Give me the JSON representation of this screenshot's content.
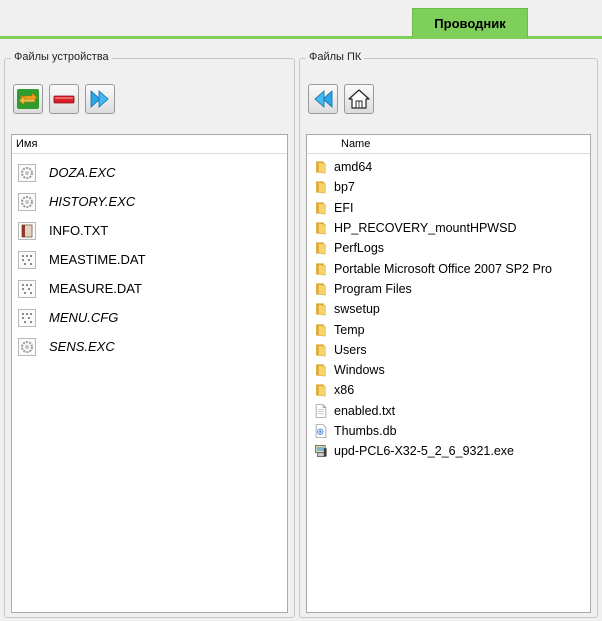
{
  "tab": {
    "label": "Проводник"
  },
  "device_panel": {
    "title": "Файлы устройства",
    "column_header": "Имя",
    "buttons": [
      {
        "name": "sync",
        "icon": "sync-arrows-icon"
      },
      {
        "name": "delete",
        "icon": "minus-icon"
      },
      {
        "name": "forward",
        "icon": "double-arrow-right-icon"
      }
    ],
    "files": [
      {
        "name": "DOZA.EXC",
        "icon": "gear-file-icon",
        "italic": true
      },
      {
        "name": "HISTORY.EXC",
        "icon": "gear-file-icon",
        "italic": true
      },
      {
        "name": "INFO.TXT",
        "icon": "text-file-icon",
        "italic": false
      },
      {
        "name": "MEASTIME.DAT",
        "icon": "data-file-icon",
        "italic": false
      },
      {
        "name": "MEASURE.DAT",
        "icon": "data-file-icon",
        "italic": false
      },
      {
        "name": "MENU.CFG",
        "icon": "data-file-icon",
        "italic": true
      },
      {
        "name": "SENS.EXC",
        "icon": "gear-file-icon",
        "italic": true
      }
    ]
  },
  "pc_panel": {
    "title": "Файлы ПК",
    "column_header": "Name",
    "buttons": [
      {
        "name": "back",
        "icon": "double-arrow-left-icon"
      },
      {
        "name": "home",
        "icon": "home-icon"
      }
    ],
    "files": [
      {
        "name": "amd64",
        "icon": "folder-icon"
      },
      {
        "name": "bp7",
        "icon": "folder-icon"
      },
      {
        "name": "EFI",
        "icon": "folder-icon"
      },
      {
        "name": "HP_RECOVERY_mountHPWSD",
        "icon": "folder-icon"
      },
      {
        "name": "PerfLogs",
        "icon": "folder-icon"
      },
      {
        "name": "Portable Microsoft Office 2007 SP2 Pro",
        "icon": "folder-icon"
      },
      {
        "name": "Program Files",
        "icon": "folder-icon"
      },
      {
        "name": "swsetup",
        "icon": "folder-icon"
      },
      {
        "name": "Temp",
        "icon": "folder-icon"
      },
      {
        "name": "Users",
        "icon": "folder-icon"
      },
      {
        "name": "Windows",
        "icon": "folder-icon"
      },
      {
        "name": "x86",
        "icon": "folder-icon"
      },
      {
        "name": "enabled.txt",
        "icon": "text-document-icon"
      },
      {
        "name": "Thumbs.db",
        "icon": "db-file-icon"
      },
      {
        "name": "upd-PCL6-X32-5_2_6_9321.exe",
        "icon": "exe-file-icon"
      }
    ]
  }
}
